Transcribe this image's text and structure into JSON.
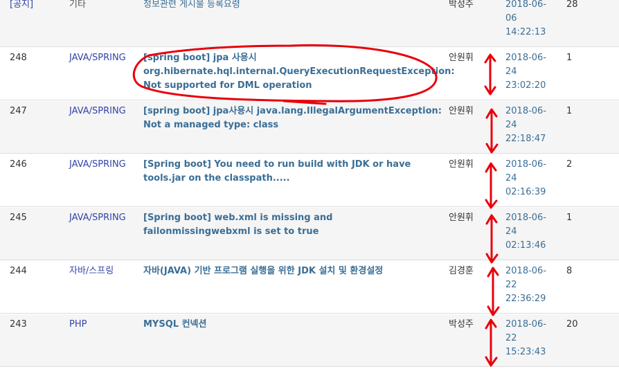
{
  "rows": [
    {
      "num": "[공지]",
      "category": "기타",
      "title": "정보관련 게시물 등록요령",
      "author": "박성주",
      "date": [
        "2018-06-",
        "06",
        "14:22:13"
      ],
      "hits": "28"
    },
    {
      "num": "248",
      "category": "JAVA/SPRING",
      "title": "[spring boot] jpa 사용시 org.hibernate.hql.internal.QueryExecutionRequestException: Not supported for DML operation",
      "author": "안원휘",
      "date": [
        "2018-06-",
        "24",
        "23:02:20"
      ],
      "hits": "1"
    },
    {
      "num": "247",
      "category": "JAVA/SPRING",
      "title": "[spring boot] jpa사용시 java.lang.IllegalArgumentException: Not a managed type: class",
      "author": "안원휘",
      "date": [
        "2018-06-",
        "24",
        "22:18:47"
      ],
      "hits": "1"
    },
    {
      "num": "246",
      "category": "JAVA/SPRING",
      "title": "[Spring boot] You need to run build with JDK or have tools.jar on the classpath.....",
      "author": "안원휘",
      "date": [
        "2018-06-",
        "24",
        "02:16:39"
      ],
      "hits": "2"
    },
    {
      "num": "245",
      "category": "JAVA/SPRING",
      "title": "[Spring boot] web.xml is missing and failonmissingwebxml is set to true",
      "author": "안원휘",
      "date": [
        "2018-06-",
        "24",
        "02:13:46"
      ],
      "hits": "1"
    },
    {
      "num": "244",
      "category": "자바/스프링",
      "title": "자바(JAVA) 기반 프로그램 실행을 위한 JDK 설치 및 환경설정",
      "author": "김경훈",
      "date": [
        "2018-06-",
        "22",
        "22:36:29"
      ],
      "hits": "8"
    },
    {
      "num": "243",
      "category": "PHP",
      "title": "MYSQL 컨넥션",
      "author": "박성주",
      "date": [
        "2018-06-",
        "22",
        "15:23:43"
      ],
      "hits": "20"
    }
  ],
  "colors": {
    "link": "#3a6e96",
    "category": "#3344aa",
    "annotation": "#e8000b",
    "shade": "#f5f5f5"
  },
  "annotations": [
    "ellipse-around-row-248-title",
    "double-arrows-between-date-rows"
  ]
}
